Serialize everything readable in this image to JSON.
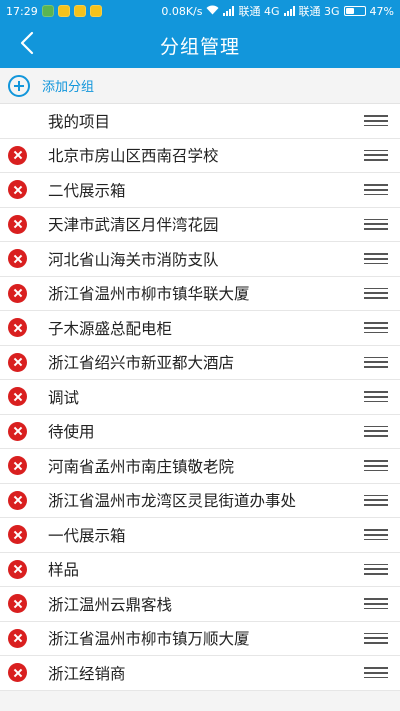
{
  "statusbar": {
    "time": "17:29",
    "speed": "0.08K/s",
    "carrier1": "联通 4G",
    "carrier2": "联通 3G",
    "battery": "47%",
    "battery_level": 0.47
  },
  "header": {
    "title": "分组管理"
  },
  "add_group": {
    "label": "添加分组"
  },
  "colors": {
    "primary": "#1296db",
    "delete": "#d91f1f"
  },
  "groups": [
    {
      "label": "我的项目",
      "deletable": false
    },
    {
      "label": "北京市房山区西南召学校",
      "deletable": true
    },
    {
      "label": "二代展示箱",
      "deletable": true
    },
    {
      "label": "天津市武清区月伴湾花园",
      "deletable": true
    },
    {
      "label": "河北省山海关市消防支队",
      "deletable": true
    },
    {
      "label": "浙江省温州市柳市镇华联大厦",
      "deletable": true
    },
    {
      "label": "子木源盛总配电柜",
      "deletable": true
    },
    {
      "label": "浙江省绍兴市新亚都大酒店",
      "deletable": true
    },
    {
      "label": "调试",
      "deletable": true
    },
    {
      "label": "待使用",
      "deletable": true
    },
    {
      "label": "河南省孟州市南庄镇敬老院",
      "deletable": true
    },
    {
      "label": "浙江省温州市龙湾区灵昆街道办事处",
      "deletable": true
    },
    {
      "label": "一代展示箱",
      "deletable": true
    },
    {
      "label": "样品",
      "deletable": true
    },
    {
      "label": "浙江温州云鼎客栈",
      "deletable": true
    },
    {
      "label": "浙江省温州市柳市镇万顺大厦",
      "deletable": true
    },
    {
      "label": "浙江经销商",
      "deletable": true
    }
  ]
}
